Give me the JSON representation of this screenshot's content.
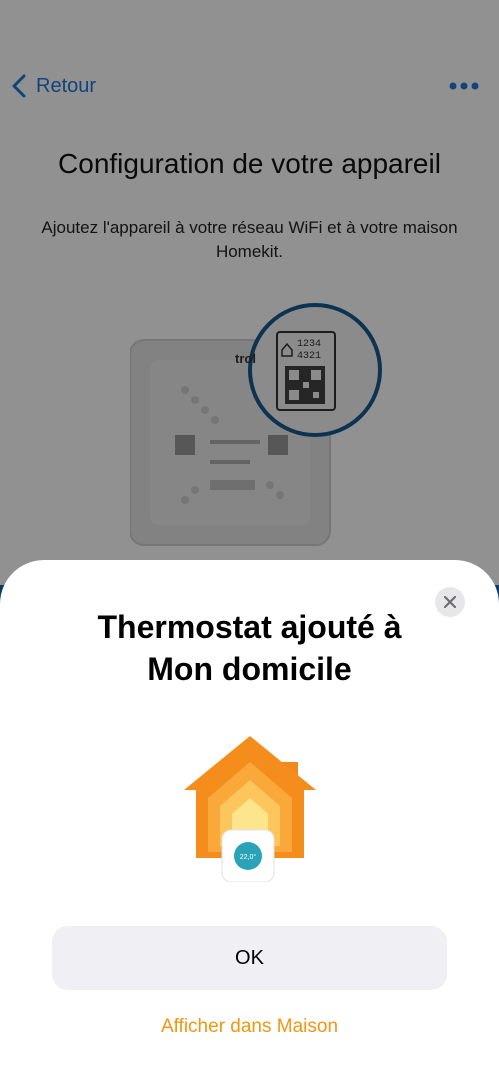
{
  "nav": {
    "back_label": "Retour",
    "back_icon": "chevron-left-icon",
    "more_icon": "ellipsis-icon"
  },
  "screen": {
    "title": "Configuration de votre appareil",
    "subtitle": "Ajoutez l'appareil à votre réseau WiFi et à votre maison Homekit.",
    "device_label_brand": "trol",
    "device_code_1": "1234",
    "device_code_2": "4321"
  },
  "sheet": {
    "title_line1": "Thermostat ajouté à",
    "title_line2": "Mon domicile",
    "thermostat_reading": "22,0°",
    "ok_label": "OK",
    "link_label": "Afficher dans Maison"
  },
  "colors": {
    "accent_blue": "#1e78d6",
    "brand_blue": "#1d67b3",
    "home_orange": "#f5a623",
    "link_orange": "#f29610",
    "thermo_teal": "#2aa3b9"
  }
}
